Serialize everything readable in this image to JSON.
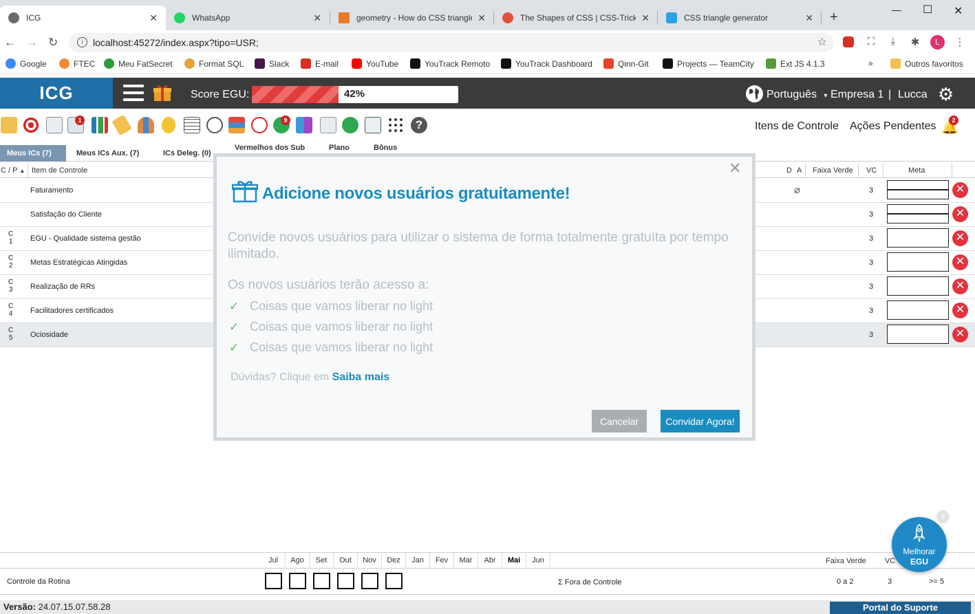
{
  "browser": {
    "tabs": [
      {
        "title": "ICG",
        "close": "✕",
        "color": "#6b6b6b"
      },
      {
        "title": "WhatsApp",
        "close": "✕",
        "color": "#25d366"
      },
      {
        "title": "geometry - How do CSS triangles work",
        "close": "✕",
        "color": "#e87a2a"
      },
      {
        "title": "The Shapes of CSS | CSS-Tricks",
        "close": "✕",
        "color": "#e0523a"
      },
      {
        "title": "CSS triangle generator",
        "close": "✕",
        "color": "#27a3e6"
      }
    ],
    "url": "localhost:45272/index.aspx?tipo=USR;",
    "profile_initial": "L",
    "bookmarks": [
      {
        "label": "Google",
        "color": "#4285f4"
      },
      {
        "label": "FTEC",
        "color": "#f08a3a"
      },
      {
        "label": "Meu FatSecret",
        "color": "#2a9a3a"
      },
      {
        "label": "Format SQL",
        "color": "#e7a33a"
      },
      {
        "label": "Slack",
        "color": "#4a154b"
      },
      {
        "label": "E-mail",
        "color": "#d93025"
      },
      {
        "label": "YouTube",
        "color": "#ff0000"
      },
      {
        "label": "YouTrack Remoto",
        "color": "#111111"
      },
      {
        "label": "YouTrack Dashboard",
        "color": "#111111"
      },
      {
        "label": "Qinn-Git",
        "color": "#e2432a"
      },
      {
        "label": "Projects — TeamCity",
        "color": "#111111"
      },
      {
        "label": "Ext JS 4.1.3",
        "color": "#5a9a3a"
      }
    ],
    "other_bookmarks": "Outros favoritos"
  },
  "header": {
    "logo": "ICG",
    "score_label": "Score EGU:",
    "score_percent_text": "42%",
    "score_fraction": 0.42,
    "language": "Português",
    "company": "Empresa 1",
    "separator": "|",
    "user": "Lucca"
  },
  "toolbar": {
    "links": [
      "Itens de Controle",
      "Ações Pendentes"
    ],
    "badges": {
      "b1": "1",
      "b2": "9",
      "bell": "2"
    }
  },
  "subtabs": [
    "Meus ICs (7)",
    "Meus ICs Aux. (7)",
    "ICs Deleg. (0)",
    "Vermelhos dos Sub",
    "Plano",
    "Bônus"
  ],
  "grid": {
    "headers": {
      "cp": "C / P",
      "item": "Item de Controle",
      "d": "D",
      "a": "A",
      "faixa": "Faixa Verde",
      "vc": "VC",
      "meta": "Meta"
    },
    "rows": [
      {
        "cp1": "",
        "cp2": "",
        "item": "Faturamento",
        "vc": "3"
      },
      {
        "cp1": "",
        "cp2": "",
        "item": "Satisfação do Cliente",
        "vc": "3"
      },
      {
        "cp1": "C",
        "cp2": "1",
        "item": "EGU - Qualidade sistema gestão",
        "vc": "3"
      },
      {
        "cp1": "C",
        "cp2": "2",
        "item": "Metas Estratégicas Atingidas",
        "vc": "3"
      },
      {
        "cp1": "C",
        "cp2": "3",
        "item": "Realização de RRs",
        "vc": "3"
      },
      {
        "cp1": "C",
        "cp2": "4",
        "item": "Facilitadores certificados",
        "vc": "3"
      },
      {
        "cp1": "C",
        "cp2": "5",
        "item": "Ociosidade",
        "vc": "3"
      }
    ]
  },
  "modal": {
    "title": "Adicione novos usuários gratuitamente!",
    "description": "Convide novos usuários para utilizar o sistema de forma totalmente gratuíta por tempo ilimitado.",
    "subtitle": "Os novos usuários terão acesso a:",
    "features": [
      "Coisas que vamos liberar no light",
      "Coisas que vamos liberar no light",
      "Coisas que vamos liberar no light"
    ],
    "doubt_prefix": "Dúvidas? Clique em",
    "doubt_link": "Saiba mais",
    "cancel": "Cancelar",
    "invite": "Convidar Agora!",
    "close": "✕"
  },
  "bottom": {
    "months": [
      "Jul",
      "Ago",
      "Set",
      "Out",
      "Nov",
      "Dez",
      "Jan",
      "Fev",
      "Mar",
      "Abr",
      "Mai",
      "Jun"
    ],
    "current_month": "Mai",
    "faixa_header": "Faixa Verde",
    "vc_header": "VC",
    "row_label": "Controle da Rotina",
    "sigma_label": "Σ Fora de Controle",
    "faixa_value": "0 a 2",
    "vc_value": "3",
    "threshold": ">= 5"
  },
  "footer": {
    "version_label": "Versão:",
    "version": "24.07.15.07.58.28",
    "portal": "Portal do Suporte"
  },
  "fab": {
    "line1": "Melhorar",
    "line2": "EGU",
    "close": "x"
  },
  "colors": {
    "accent": "#1a8dc0",
    "header": "#3b3b3b",
    "logo": "#1f6fa8",
    "danger": "#e0343f"
  }
}
